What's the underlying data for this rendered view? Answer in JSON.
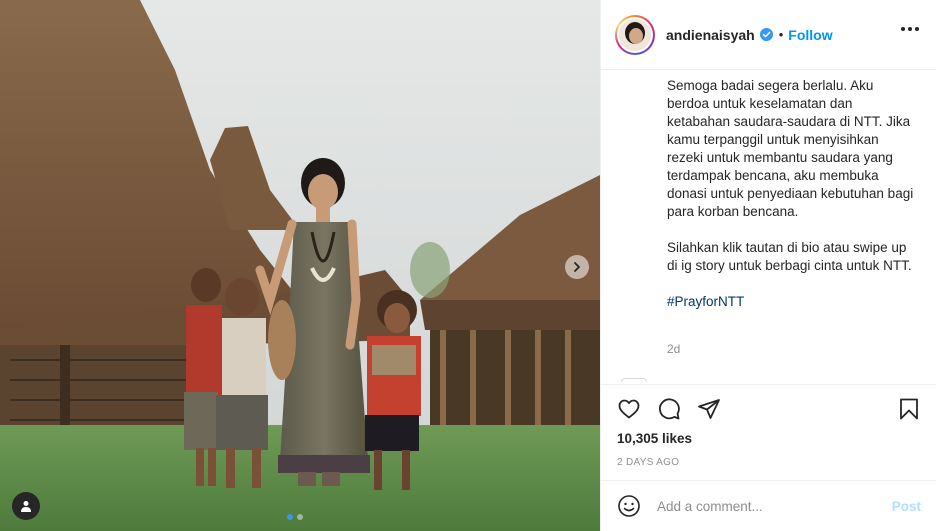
{
  "post": {
    "username": "andienaisyah",
    "follow_label": "Follow",
    "bullet": "•",
    "caption_paragraphs": [
      "Semoga badai segera berlalu. Aku berdoa untuk keselamatan dan ketabahan saudara-saudara di NTT. Jika kamu terpanggil untuk menyisihkan rezeki untuk membantu saudara yang terdampak bencana, aku membuka donasi untuk penyediaan kebutuhan bagi para korban bencana.",
      "Silahkan klik tautan di bio atau swipe up di ig story untuk berbagi cinta untuk NTT."
    ],
    "hashtag": "#PrayforNTT",
    "caption_time": "2d",
    "likes": "10,305 likes",
    "date": "2 DAYS AGO",
    "comment_placeholder": "Add a comment...",
    "post_label": "Post"
  },
  "carousel": {
    "slides": 2,
    "active_slide": 1
  },
  "colors": {
    "accent": "#0095f6",
    "post_disabled": "#b2dffc",
    "hashtag": "#00376b",
    "muted": "#8e8e8e"
  },
  "icons": [
    "verified-badge-icon",
    "more-options-icon",
    "heart-icon",
    "comment-icon",
    "share-icon",
    "bookmark-icon",
    "emoji-icon",
    "chevron-right-icon",
    "user-tag-icon"
  ]
}
